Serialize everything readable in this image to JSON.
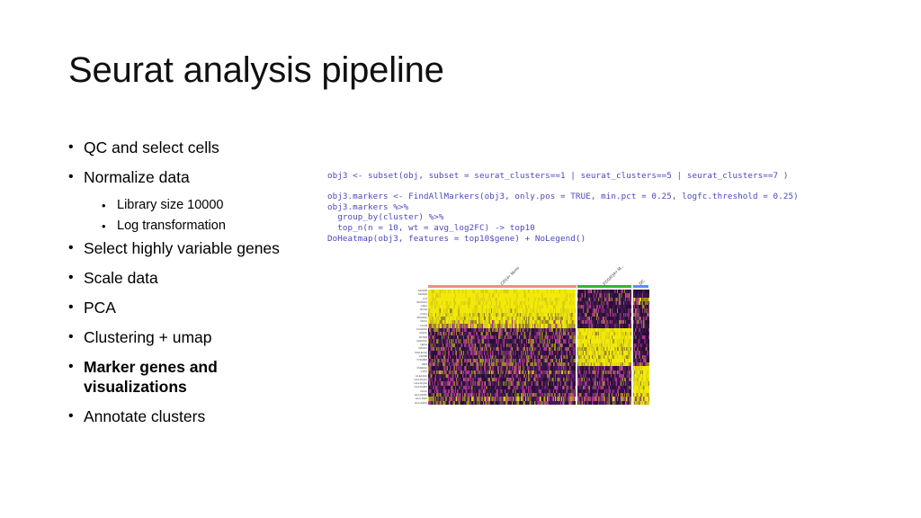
{
  "slide": {
    "title": "Seurat analysis pipeline",
    "background_color": "#ffffff"
  },
  "bullets": [
    {
      "level": 1,
      "text": "QC and select cells",
      "bold": false
    },
    {
      "level": 1,
      "text": "Normalize data",
      "bold": false
    },
    {
      "level": 2,
      "text": "Library size 10000",
      "bold": false
    },
    {
      "level": 2,
      "text": "Log transformation",
      "bold": false
    },
    {
      "level": 1,
      "text": "Select highly variable genes",
      "bold": false
    },
    {
      "level": 1,
      "text": "Scale data",
      "bold": false
    },
    {
      "level": 1,
      "text": "PCA",
      "bold": false
    },
    {
      "level": 1,
      "text": "Clustering + umap",
      "bold": false
    },
    {
      "level": 1,
      "text": "Marker genes and visualizations",
      "bold": true
    },
    {
      "level": 1,
      "text": "Annotate clusters",
      "bold": false
    }
  ],
  "code": {
    "color": "#4b47bd",
    "lines": [
      "obj3 <- subset(obj, subset = seurat_clusters==1 | seurat_clusters==5 | seurat_clusters==7 )",
      "",
      "obj3.markers <- FindAllMarkers(obj3, only.pos = TRUE, min.pct = 0.25, logfc.threshold = 0.25)",
      "obj3.markers %>%",
      "  group_by(cluster) %>%",
      "  top_n(n = 10, wt = avg_log2FC) -> top10",
      "DoHeatmap(obj3, features = top10$gene) + NoLegend()"
    ]
  },
  "heatmap": {
    "type": "heatmap",
    "title": "",
    "colormap": {
      "high": "#f2e90a",
      "mid": "#a8338c",
      "low": "#431d56",
      "dark": "#2a1038"
    },
    "clusters": [
      {
        "label": "CD14+ Mono",
        "bar_color": "#f08d82",
        "width_fraction": 0.665
      },
      {
        "label": "FCGR3A+ M...",
        "bar_color": "#2fb62f",
        "width_fraction": 0.245
      },
      {
        "label": "DC",
        "bar_color": "#5b8ef0",
        "width_fraction": 0.075
      }
    ],
    "genes": [
      "S100A8",
      "S100A9",
      "LYZ",
      "S100A12",
      "CD14",
      "RGS2",
      "FCN1",
      "MS4A6A",
      "NCF1",
      "VCAN",
      "FCGR3A",
      "RHOC",
      "IFITM3",
      "CDKN1C",
      "HES4",
      "MS4A7",
      "SIGLEC10",
      "CD79B",
      "TYROBP",
      "ABI3",
      "FCER1A",
      "CST3",
      "CLEC10A",
      "HLA-DQA1",
      "HLA-DQA2",
      "HLA-DQB1",
      "CD1C",
      "HLA-DPB1",
      "HLA-DRA",
      "HLA-DPA1"
    ],
    "row_band_values": [
      [
        0.95,
        0.22,
        0.1
      ],
      [
        0.95,
        0.25,
        0.12
      ],
      [
        0.92,
        0.3,
        0.55
      ],
      [
        0.9,
        0.2,
        0.45
      ],
      [
        0.88,
        0.18,
        0.2
      ],
      [
        0.84,
        0.22,
        0.25
      ],
      [
        0.8,
        0.26,
        0.3
      ],
      [
        0.74,
        0.2,
        0.22
      ],
      [
        0.7,
        0.25,
        0.26
      ],
      [
        0.62,
        0.18,
        0.2
      ],
      [
        0.3,
        0.88,
        0.18
      ],
      [
        0.26,
        0.82,
        0.16
      ],
      [
        0.28,
        0.86,
        0.2
      ],
      [
        0.24,
        0.84,
        0.18
      ],
      [
        0.26,
        0.8,
        0.16
      ],
      [
        0.3,
        0.78,
        0.22
      ],
      [
        0.22,
        0.76,
        0.18
      ],
      [
        0.24,
        0.72,
        0.2
      ],
      [
        0.34,
        0.8,
        0.26
      ],
      [
        0.3,
        0.74,
        0.22
      ],
      [
        0.22,
        0.2,
        0.85
      ],
      [
        0.38,
        0.3,
        0.8
      ],
      [
        0.2,
        0.18,
        0.88
      ],
      [
        0.24,
        0.26,
        0.82
      ],
      [
        0.22,
        0.24,
        0.8
      ],
      [
        0.2,
        0.22,
        0.78
      ],
      [
        0.18,
        0.16,
        0.86
      ],
      [
        0.32,
        0.3,
        0.74
      ],
      [
        0.4,
        0.34,
        0.7
      ],
      [
        0.3,
        0.28,
        0.72
      ]
    ]
  }
}
